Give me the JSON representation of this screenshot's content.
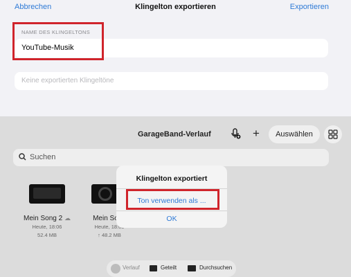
{
  "export_sheet": {
    "cancel_label": "Abbrechen",
    "title": "Klingelton exportieren",
    "export_label": "Exportieren",
    "name_section_label": "NAME DES KLINGELTONS",
    "name_value": "YouTube-Musik",
    "no_exported_text": "Keine exportierten Klingeltöne"
  },
  "garageband": {
    "title": "GarageBand-Verlauf",
    "select_label": "Auswählen",
    "search_placeholder": "Suchen",
    "songs": [
      {
        "name": "Mein Song 2",
        "date": "Heute, 18:06",
        "size": "52.4 MB"
      },
      {
        "name": "Mein Song",
        "date": "Heute, 18:05",
        "size": "↑ 48.2 MB"
      }
    ],
    "tabs": [
      {
        "label": "Verlauf"
      },
      {
        "label": "Geteilt"
      },
      {
        "label": "Durchsuchen"
      }
    ]
  },
  "alert": {
    "title": "Klingelton exportiert",
    "action_label": "Ton verwenden als ...",
    "ok_label": "OK"
  },
  "colors": {
    "accent": "#2e7ad6",
    "highlight": "#d0242b"
  }
}
